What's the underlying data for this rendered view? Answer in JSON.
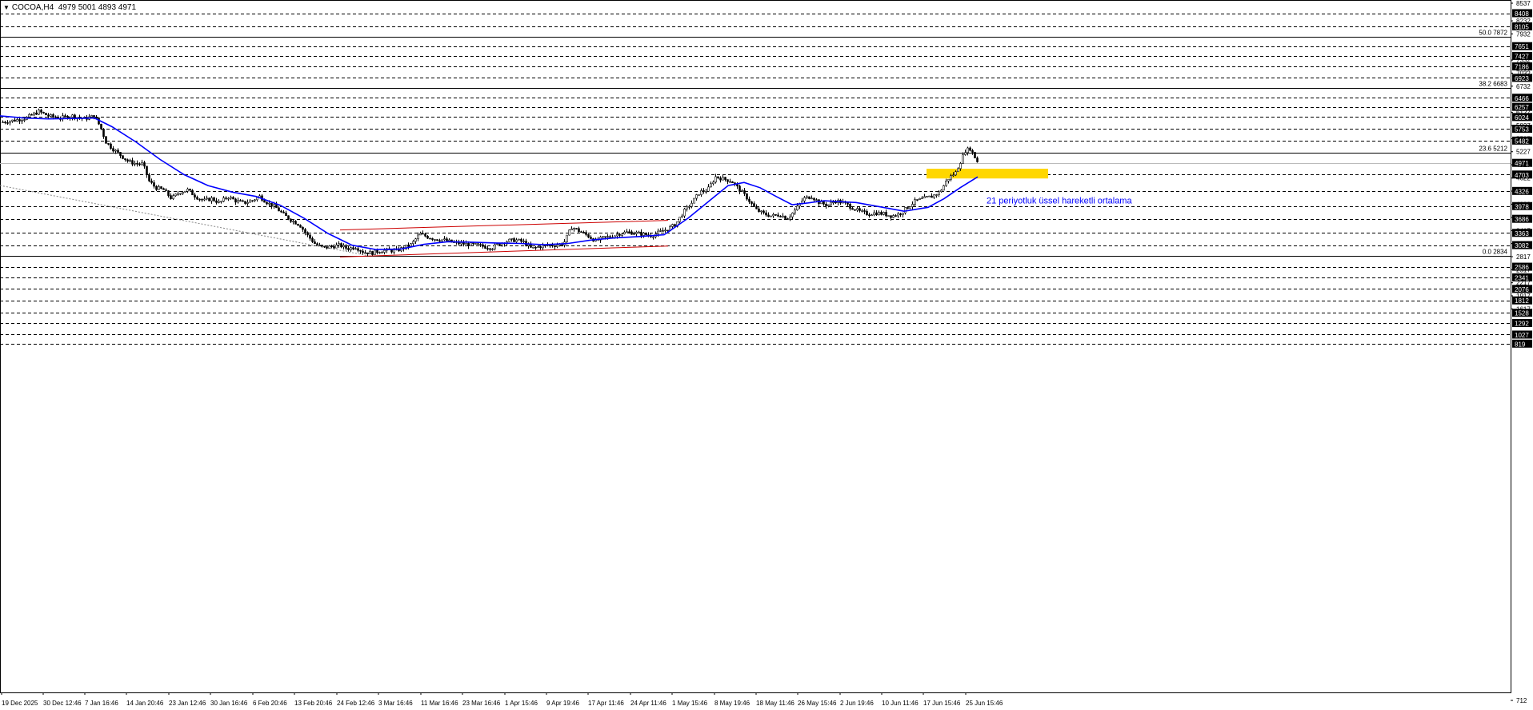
{
  "header": {
    "symbol": "COCOA,H4",
    "ohlc": "4979 5001 4893 4971",
    "toggle_glyph": "▼"
  },
  "colors": {
    "candle": "#000000",
    "ema": "#0000ff",
    "channel": "#cc0000",
    "zone": "#ffd700",
    "grid": "#000000",
    "box_bg": "#000000",
    "box_fg": "#ffffff"
  },
  "chart_data": {
    "type": "candlestick",
    "y_range": [
      712,
      8537
    ],
    "x_labels": [
      "19 Dec 2025",
      "30 Dec 12:46",
      "7 Jan 16:46",
      "14 Jan 20:46",
      "23 Jan 12:46",
      "30 Jan 16:46",
      "6 Feb 20:46",
      "13 Feb 20:46",
      "24 Feb 12:46",
      "3 Mar 16:46",
      "11 Mar 16:46",
      "23 Mar 16:46",
      "1 Apr 15:46",
      "9 Apr 19:46",
      "17 Apr 11:46",
      "24 Apr 11:46",
      "1 May 15:46",
      "8 May 19:46",
      "18 May 11:46",
      "26 May 15:46",
      "2 Jun 19:46",
      "10 Jun 11:46",
      "17 Jun 15:46",
      "25 Jun 15:46"
    ],
    "y_ticks": [
      "8537",
      "8232",
      "7932",
      "7332",
      "7032",
      "6732",
      "6127",
      "5827",
      "5527",
      "5227",
      "4927",
      "4622",
      "4322",
      "4022",
      "3717",
      "3417",
      "3117",
      "2817",
      "2517",
      "2217",
      "1917",
      "1617",
      "712"
    ],
    "boxed_levels": [
      "8408",
      "8105",
      "7651",
      "7427",
      "7186",
      "6923",
      "6466",
      "6257",
      "6024",
      "5753",
      "5482",
      "4971",
      "4703",
      "4326",
      "3978",
      "3686",
      "3363",
      "3082",
      "2586",
      "2341",
      "2076",
      "1812",
      "1528",
      "1292",
      "1027",
      "819"
    ],
    "current_price": "4971",
    "fib_levels": [
      {
        "label": "50.0 7872",
        "price": 7872
      },
      {
        "label": "38.2 6683",
        "price": 6683
      },
      {
        "label": "23.6 5212",
        "price": 5212
      },
      {
        "label": "0.0 2834",
        "price": 2834
      }
    ],
    "ema_label": "21 periyotluk üssel hareketli ortalama",
    "support_zone": [
      4612,
      4836
    ],
    "close_path": [
      [
        0,
        5900
      ],
      [
        18,
        5950
      ],
      [
        32,
        6000
      ],
      [
        48,
        6150
      ],
      [
        60,
        6050
      ],
      [
        74,
        6000
      ],
      [
        90,
        6050
      ],
      [
        104,
        5980
      ],
      [
        118,
        6050
      ],
      [
        126,
        5750
      ],
      [
        132,
        5450
      ],
      [
        140,
        5300
      ],
      [
        150,
        5150
      ],
      [
        160,
        5000
      ],
      [
        170,
        4950
      ],
      [
        178,
        4950
      ],
      [
        186,
        4550
      ],
      [
        194,
        4400
      ],
      [
        204,
        4350
      ],
      [
        214,
        4150
      ],
      [
        224,
        4300
      ],
      [
        234,
        4350
      ],
      [
        244,
        4200
      ],
      [
        254,
        4100
      ],
      [
        264,
        4150
      ],
      [
        274,
        4050
      ],
      [
        284,
        4200
      ],
      [
        294,
        4100
      ],
      [
        304,
        4050
      ],
      [
        314,
        4100
      ],
      [
        324,
        4200
      ],
      [
        334,
        4050
      ],
      [
        344,
        3950
      ],
      [
        354,
        3780
      ],
      [
        364,
        3650
      ],
      [
        374,
        3550
      ],
      [
        384,
        3300
      ],
      [
        394,
        3100
      ],
      [
        404,
        3020
      ],
      [
        414,
        3050
      ],
      [
        424,
        3080
      ],
      [
        434,
        3000
      ],
      [
        444,
        3040
      ],
      [
        454,
        2920
      ],
      [
        464,
        2900
      ],
      [
        474,
        2950
      ],
      [
        484,
        2960
      ],
      [
        494,
        2950
      ],
      [
        504,
        3020
      ],
      [
        514,
        3100
      ],
      [
        524,
        3340
      ],
      [
        534,
        3270
      ],
      [
        544,
        3220
      ],
      [
        554,
        3200
      ],
      [
        564,
        3150
      ],
      [
        574,
        3120
      ],
      [
        584,
        3100
      ],
      [
        594,
        3080
      ],
      [
        604,
        3050
      ],
      [
        614,
        3020
      ],
      [
        624,
        3120
      ],
      [
        634,
        3180
      ],
      [
        644,
        3200
      ],
      [
        654,
        3150
      ],
      [
        664,
        3000
      ],
      [
        674,
        3050
      ],
      [
        684,
        3080
      ],
      [
        694,
        3080
      ],
      [
        704,
        3120
      ],
      [
        714,
        3500
      ],
      [
        724,
        3400
      ],
      [
        734,
        3300
      ],
      [
        744,
        3180
      ],
      [
        754,
        3250
      ],
      [
        764,
        3280
      ],
      [
        774,
        3350
      ],
      [
        784,
        3380
      ],
      [
        794,
        3360
      ],
      [
        804,
        3330
      ],
      [
        814,
        3300
      ],
      [
        824,
        3380
      ],
      [
        834,
        3450
      ],
      [
        844,
        3560
      ],
      [
        854,
        3850
      ],
      [
        864,
        4050
      ],
      [
        874,
        4300
      ],
      [
        884,
        4350
      ],
      [
        894,
        4650
      ],
      [
        904,
        4600
      ],
      [
        914,
        4550
      ],
      [
        924,
        4350
      ],
      [
        934,
        4150
      ],
      [
        944,
        3900
      ],
      [
        954,
        3800
      ],
      [
        964,
        3750
      ],
      [
        974,
        3780
      ],
      [
        984,
        3700
      ],
      [
        994,
        3900
      ],
      [
        1004,
        4150
      ],
      [
        1014,
        4200
      ],
      [
        1024,
        4050
      ],
      [
        1034,
        4000
      ],
      [
        1044,
        4100
      ],
      [
        1054,
        4050
      ],
      [
        1064,
        3950
      ],
      [
        1074,
        3850
      ],
      [
        1084,
        3800
      ],
      [
        1094,
        3820
      ],
      [
        1104,
        3800
      ],
      [
        1114,
        3750
      ],
      [
        1124,
        3800
      ],
      [
        1134,
        3950
      ],
      [
        1144,
        4100
      ],
      [
        1154,
        4150
      ],
      [
        1164,
        4200
      ],
      [
        1174,
        4300
      ],
      [
        1184,
        4600
      ],
      [
        1194,
        4750
      ],
      [
        1200,
        5000
      ],
      [
        1206,
        5250
      ],
      [
        1212,
        5300
      ],
      [
        1218,
        5100
      ],
      [
        1222,
        4971
      ]
    ],
    "ema_path": [
      [
        0,
        6050
      ],
      [
        30,
        6000
      ],
      [
        60,
        5980
      ],
      [
        90,
        5990
      ],
      [
        118,
        6000
      ],
      [
        140,
        5800
      ],
      [
        170,
        5450
      ],
      [
        200,
        5050
      ],
      [
        230,
        4700
      ],
      [
        260,
        4450
      ],
      [
        290,
        4300
      ],
      [
        320,
        4200
      ],
      [
        350,
        4000
      ],
      [
        380,
        3700
      ],
      [
        410,
        3350
      ],
      [
        440,
        3080
      ],
      [
        470,
        2980
      ],
      [
        500,
        2990
      ],
      [
        530,
        3100
      ],
      [
        560,
        3160
      ],
      [
        590,
        3150
      ],
      [
        620,
        3130
      ],
      [
        650,
        3120
      ],
      [
        680,
        3090
      ],
      [
        710,
        3120
      ],
      [
        740,
        3200
      ],
      [
        770,
        3250
      ],
      [
        800,
        3280
      ],
      [
        830,
        3320
      ],
      [
        860,
        3700
      ],
      [
        890,
        4150
      ],
      [
        910,
        4450
      ],
      [
        930,
        4520
      ],
      [
        950,
        4400
      ],
      [
        970,
        4200
      ],
      [
        990,
        4010
      ],
      [
        1010,
        4050
      ],
      [
        1030,
        4100
      ],
      [
        1050,
        4080
      ],
      [
        1070,
        4060
      ],
      [
        1100,
        3960
      ],
      [
        1130,
        3860
      ],
      [
        1160,
        3950
      ],
      [
        1180,
        4150
      ],
      [
        1200,
        4400
      ],
      [
        1222,
        4650
      ]
    ],
    "channel_lines": [
      [
        [
          425,
          3430
        ],
        [
          835,
          3650
        ]
      ],
      [
        [
          425,
          2810
        ],
        [
          835,
          3060
        ]
      ]
    ],
    "trend_line": [
      [
        0,
        4450
      ],
      [
        460,
        2840
      ]
    ]
  }
}
